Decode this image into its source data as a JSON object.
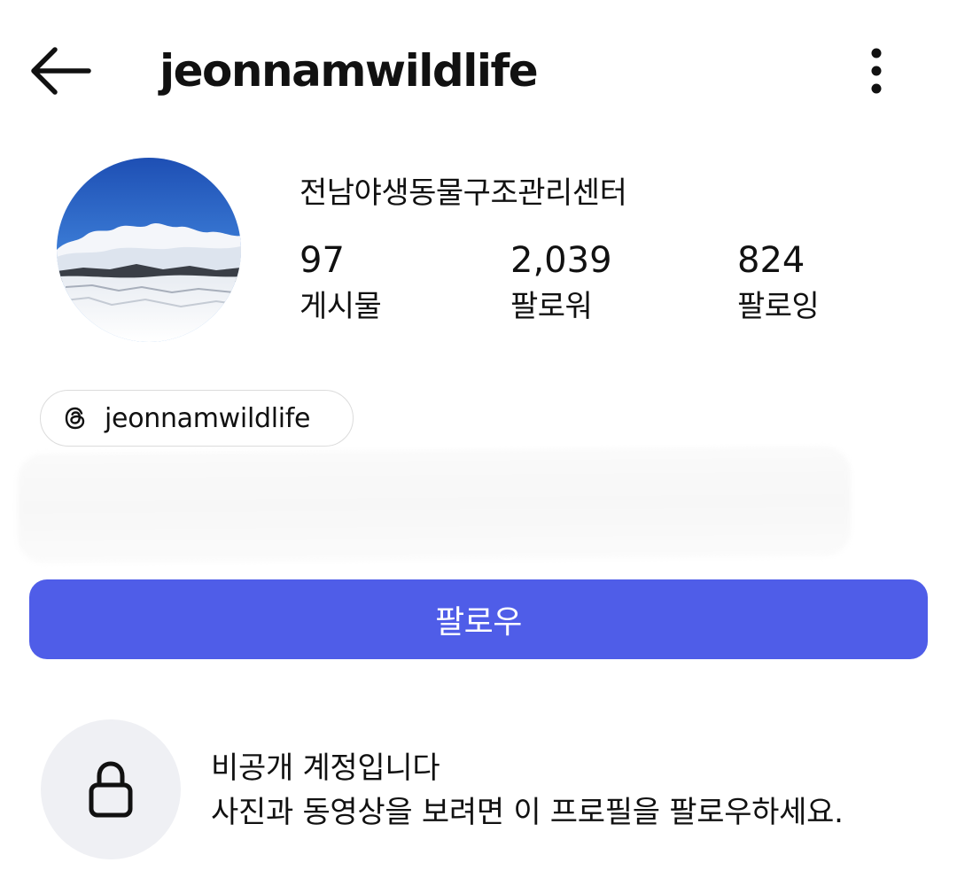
{
  "header": {
    "username": "jeonnamwildlife"
  },
  "profile": {
    "display_name": "전남야생동물구조관리센터",
    "stats": [
      {
        "value": "97",
        "label": "게시물"
      },
      {
        "value": "2,039",
        "label": "팔로워"
      },
      {
        "value": "824",
        "label": "팔로잉"
      }
    ],
    "threads_handle": "jeonnamwildlife"
  },
  "actions": {
    "follow_label": "팔로우"
  },
  "private_notice": {
    "title": "비공개 계정입니다",
    "description": "사진과 동영상을 보려면 이 프로필을 팔로우하세요."
  },
  "colors": {
    "accent": "#4f5de8",
    "lock_bg": "#eff0f4",
    "chip_border": "#dcdcdc"
  },
  "icons": {
    "back": "arrow-left-icon",
    "more": "vertical-ellipsis-icon",
    "threads": "threads-logo-icon",
    "lock": "lock-icon"
  }
}
